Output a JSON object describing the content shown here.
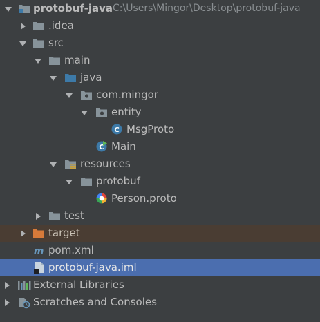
{
  "project": {
    "name": "protobuf-java",
    "path": "C:\\Users\\Mingor\\Desktop\\protobuf-java"
  },
  "nodes": {
    "idea": ".idea",
    "src": "src",
    "main": "main",
    "java": "java",
    "com_mingor": "com.mingor",
    "entity": "entity",
    "msgproto": "MsgProto",
    "main_class": "Main",
    "resources": "resources",
    "protobuf": "protobuf",
    "person_proto": "Person.proto",
    "test": "test",
    "target": "target",
    "pom": "pom.xml",
    "iml": "protobuf-java.iml",
    "external_libraries": "External Libraries",
    "scratches": "Scratches and Consoles"
  },
  "icons": {
    "project": "module-folder-icon",
    "folder": "folder-icon",
    "source_root": "source-root-folder-icon",
    "package": "package-icon",
    "class": "java-class-icon",
    "main_class": "runnable-class-icon",
    "resources": "resources-root-folder-icon",
    "excluded": "excluded-folder-icon",
    "maven": "maven-icon",
    "iml": "iml-file-icon",
    "proto": "proto-file-icon",
    "libraries": "libraries-icon",
    "scratches": "scratches-icon"
  },
  "colors": {
    "background": "#3c3f41",
    "selection": "#4b6eaf",
    "target_highlight": "#4a3d33",
    "text": "#bbbbbb",
    "folder": "#87939a",
    "source_folder": "#3d7aa8",
    "excluded_folder": "#d67a3a"
  }
}
